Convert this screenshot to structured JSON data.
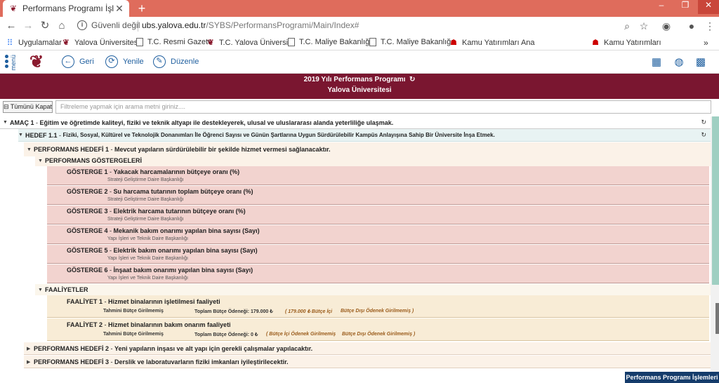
{
  "browser": {
    "tab_title": "Performans Programı İşlemleri",
    "security_label": "Güvenli değil",
    "url_host": "ubs.yalova.edu.tr",
    "url_path": "/SYBS/PerformansProgrami/Main/Index#",
    "bookmarks": [
      {
        "label": "Uygulamalar",
        "icon": "apps-grid-icon"
      },
      {
        "label": "Yalova Üniversitesi",
        "icon": "yalova-logo-icon"
      },
      {
        "label": "T.C. Resmi Gazete",
        "icon": "document-icon"
      },
      {
        "label": "T.C. Yalova Üniversite",
        "icon": "yalova-logo-icon"
      },
      {
        "label": "T.C. Maliye Bakanlığı",
        "icon": "document-icon"
      },
      {
        "label": "T.C. Maliye Bakanlığı",
        "icon": "document-icon"
      },
      {
        "label": "Kamu Yatırımları Ana",
        "icon": "red-logo-icon"
      },
      {
        "label": "Kamu Yatırımları",
        "icon": "red-logo-icon"
      }
    ]
  },
  "app": {
    "menu_label": "menü",
    "toolbar": {
      "back_label": "Geri",
      "new_label": "Yenile",
      "edit_label": "Düzenle"
    },
    "header_line1": "2019 Yılı Performans Programı",
    "header_line2": "Yalova Üniversitesi",
    "collapse_label": "Tümünü Kapat",
    "filter_placeholder": "Filtreleme yapmak için arama metni giriniz....",
    "amac": {
      "code": "AMAÇ 1",
      "text": "Eğitim ve öğretimde kaliteyi, fiziki ve teknik altyapı ile destekleyerek, ulusal ve uluslararası alanda yeterliliğe ulaşmak."
    },
    "hedef": {
      "code": "HEDEF 1.1",
      "text": "Fiziki, Sosyal, Kültürel ve Teknolojik Donanımları İle Öğrenci Sayısı ve Günün Şartlarına Uygun Sürdürülebilir Kampüs Anlayışına Sahip Bir Üniversite İnşa Etmek."
    },
    "perf_hedef_1": {
      "code": "PERFORMANS HEDEFİ 1",
      "text": "Mevcut yapıların sürdürülebilir bir şekilde hizmet vermesi sağlanacaktır."
    },
    "perf_gostergeleri_label": "PERFORMANS GÖSTERGELERİ",
    "gostergeler": [
      {
        "code": "GÖSTERGE 1",
        "text": "Yakacak harcamalarının bütçeye oranı (%)",
        "unit": "Strateji Geliştirme Daire Başkanlığı"
      },
      {
        "code": "GÖSTERGE 2",
        "text": "Su harcama tutarının toplam bütçeye oranı (%)",
        "unit": "Strateji Geliştirme Daire Başkanlığı"
      },
      {
        "code": "GÖSTERGE 3",
        "text": "Elektrik harcama tutarının bütçeye oranı (%)",
        "unit": "Strateji Geliştirme Daire Başkanlığı"
      },
      {
        "code": "GÖSTERGE 4",
        "text": "Mekanik bakım onarımı yapılan bina sayısı (Sayı)",
        "unit": "Yapı İşleri ve Teknik Daire Başkanlığı"
      },
      {
        "code": "GÖSTERGE 5",
        "text": "Elektrik bakım onarımı yapılan bina sayısı (Sayı)",
        "unit": "Yapı İşleri ve Teknik Daire Başkanlığı"
      },
      {
        "code": "GÖSTERGE 6",
        "text": "İnşaat bakım onarımı yapılan bina sayısı (Sayı)",
        "unit": "Yapı İşleri ve Teknik Daire Başkanlığı"
      }
    ],
    "faaliyetler_label": "FAALİYETLER",
    "faaliyetler": [
      {
        "code": "FAALİYET 1",
        "text": "Hizmet binalarının işletilmesi faaliyeti",
        "budget_est": "Tahmini Bütçe Girilmemiş",
        "total": "Toplam Bütçe Ödeneği: 179.000 ₺",
        "detail1": "( 179.000 ₺ Bütçe İçi",
        "detail2": "Bütçe Dışı Ödenek Girilmemiş )"
      },
      {
        "code": "FAALİYET 2",
        "text": "Hizmet binalarının bakım onarım faaliyeti",
        "budget_est": "Tahmini Bütçe Girilmemiş",
        "total": "Toplam Bütçe Ödeneği: 0 ₺",
        "detail1": "( Bütçe İçi Ödenek Girilmemiş",
        "detail2": "Bütçe Dışı Ödenek Girilmemiş )"
      }
    ],
    "perf_hedef_2": {
      "code": "PERFORMANS HEDEFİ 2",
      "text": "Yeni yapıların inşası ve alt yapı için gerekli çalışmalar yapılacaktır."
    },
    "perf_hedef_3": {
      "code": "PERFORMANS HEDEFİ 3",
      "text": "Derslik ve laboratuvarların fiziki imkanları iyileştirilecektir."
    },
    "bottom_tab": "Performans Programı İşlemleri"
  }
}
